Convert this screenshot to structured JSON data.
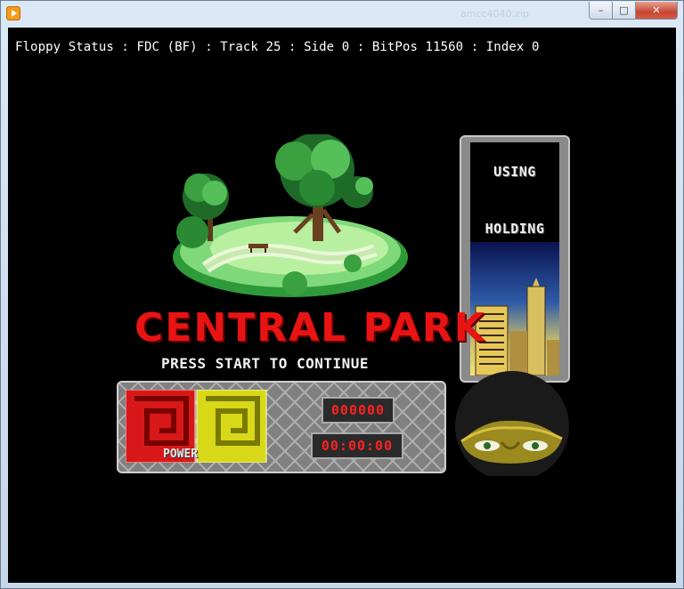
{
  "window": {
    "title_ghost": "amcc4040.zip"
  },
  "status": {
    "line": "Floppy Status : FDC (BF) : Track 25 : Side 0 : BitPos 11560 : Index 0"
  },
  "game": {
    "title": "CENTRAL PARK",
    "prompt": "PRESS START TO CONTINUE",
    "side_panel": {
      "using_label": "USING",
      "holding_label": "HOLDING"
    },
    "hud": {
      "score": "000000",
      "timer": "00:00:00",
      "power_label": "POWER"
    }
  },
  "colors": {
    "title_red": "#e81414",
    "counter_red": "#ff2222",
    "grass_light": "#b8f0a0",
    "grass_dark": "#2e9a3a",
    "panel_grey": "#808080"
  }
}
